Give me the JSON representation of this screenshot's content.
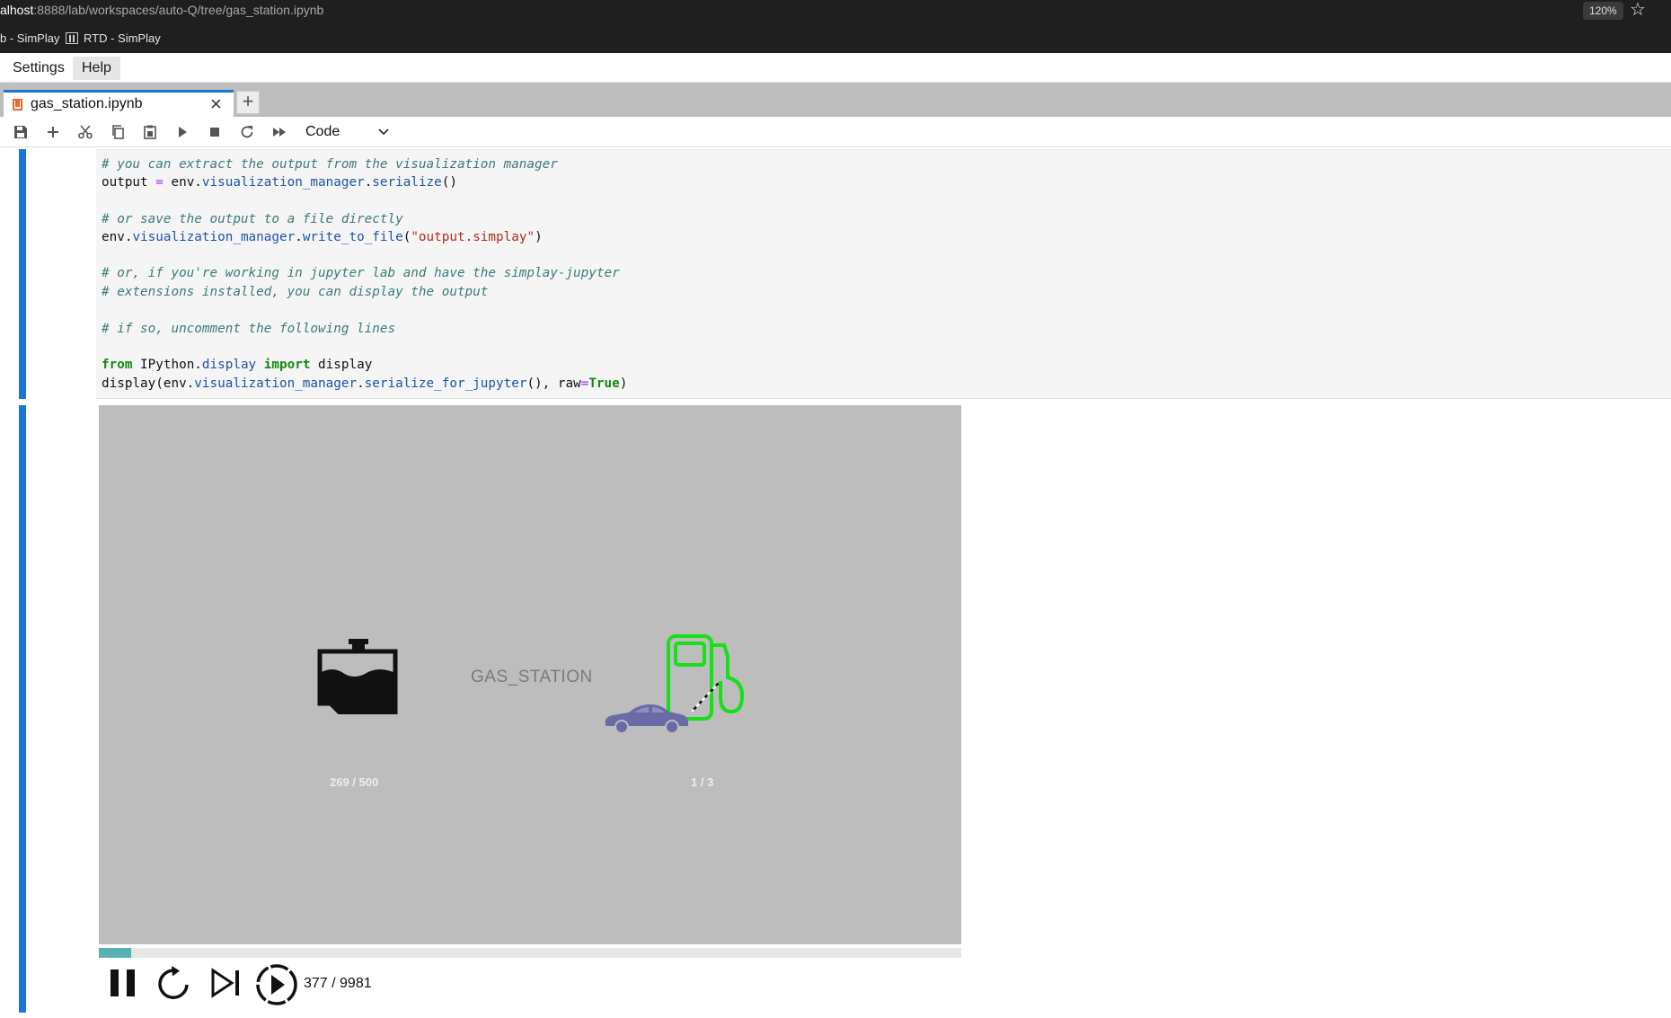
{
  "browser": {
    "url_host": "alhost",
    "url_path": ":8888/lab/workspaces/auto-Q/tree/gas_station.ipynb",
    "zoom": "120%",
    "bookmarks": [
      {
        "label": "b - SimPlay"
      },
      {
        "label": "RTD - SimPlay"
      }
    ]
  },
  "menu": {
    "items": [
      {
        "label": "Settings"
      },
      {
        "label": "Help"
      }
    ]
  },
  "tabs": {
    "active": {
      "label": "gas_station.ipynb"
    }
  },
  "toolbar": {
    "cell_type": "Code",
    "icons": [
      "save-icon",
      "add-icon",
      "cut-icon",
      "copy-icon",
      "paste-icon",
      "run-icon",
      "stop-icon",
      "restart-icon",
      "fast-forward-icon"
    ]
  },
  "code": {
    "lines": [
      "# you can extract the output from the visualization manager",
      "output = env.visualization_manager.serialize()",
      "",
      "# or save the output to a file directly",
      "env.visualization_manager.write_to_file(\"output.simplay\")",
      "",
      "# or, if you're working in jupyter lab and have the simplay-jupyter",
      "# extensions installed, you can display the output",
      "",
      "# if so, uncomment the following lines",
      "",
      "from IPython.display import display",
      "display(env.visualization_manager.serialize_for_jupyter(), raw=True)"
    ]
  },
  "viz": {
    "station_label": "GAS_STATION",
    "tank_count": "269 / 500",
    "pump_count": "1 / 3",
    "progress_fraction": 0.0378,
    "frame_counter": "377 / 9981",
    "colors": {
      "background": "#bdbdbd",
      "pump": "#16e016",
      "car": "#6c6aa6",
      "progress": "#59b0b4"
    }
  }
}
